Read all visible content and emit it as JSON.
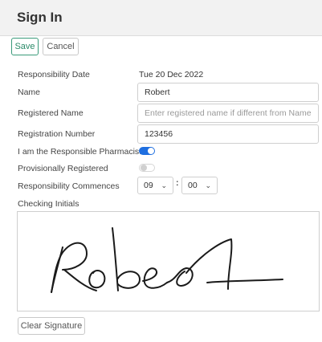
{
  "header": {
    "title": "Sign In"
  },
  "toolbar": {
    "save_label": "Save",
    "cancel_label": "Cancel"
  },
  "form": {
    "responsibility_date": {
      "label": "Responsibility Date",
      "value": "Tue 20 Dec 2022"
    },
    "name": {
      "label": "Name",
      "value": "Robert"
    },
    "registered_name": {
      "label": "Registered Name",
      "value": "",
      "placeholder": "Enter registered name if different from Name"
    },
    "registration_number": {
      "label": "Registration Number",
      "value": "123456"
    },
    "responsible_pharmacist": {
      "label": "I am the Responsible Pharmacist",
      "checked": true
    },
    "provisionally_registered": {
      "label": "Provisionally Registered",
      "checked": false
    },
    "responsibility_commences": {
      "label": "Responsibility Commences",
      "hour": "09",
      "minute": "00",
      "separator": ":"
    },
    "checking_initials": {
      "label": "Checking Initials"
    }
  },
  "signature": {
    "clear_label": "Clear Signature"
  },
  "colors": {
    "accent": "#1f6fe0",
    "save_border": "#3a9a7a",
    "header_bg": "#f2f2f2"
  },
  "icons": {
    "select_chevron": "chevron-down-icon"
  }
}
